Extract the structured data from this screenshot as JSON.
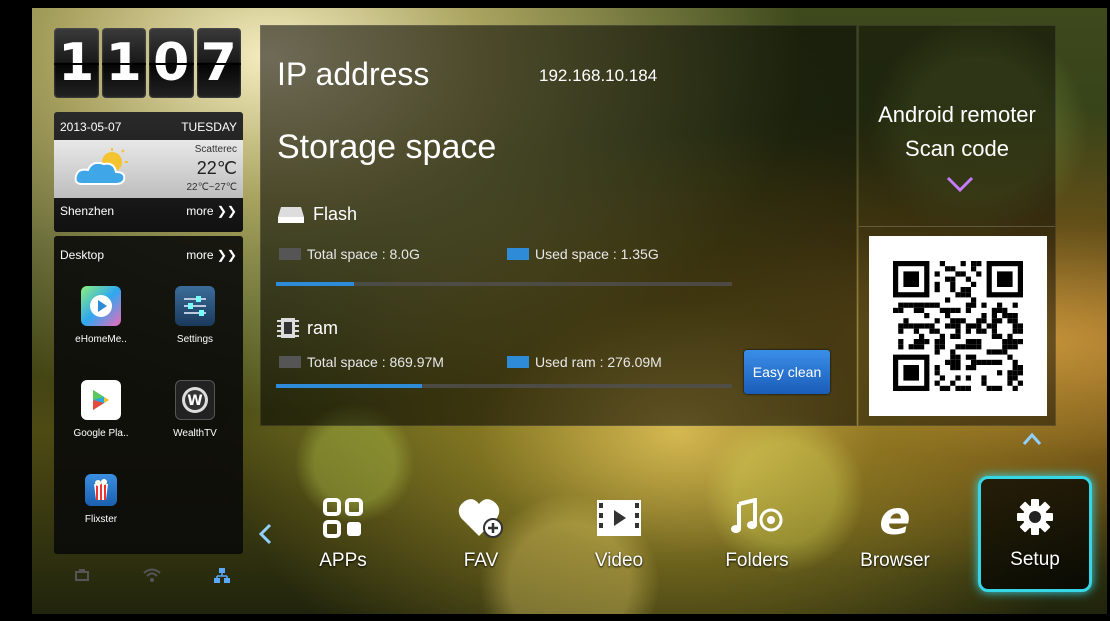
{
  "clock": {
    "digits": [
      "1",
      "1",
      "0",
      "7"
    ]
  },
  "weather": {
    "date": "2013-05-07",
    "weekday": "TUESDAY",
    "description": "Scatterec",
    "temperature": "22℃",
    "range": "22℃~27℃",
    "city": "Shenzhen",
    "more": "more ❯❯"
  },
  "desktop": {
    "title": "Desktop",
    "more": "more ❯❯",
    "apps": [
      {
        "label": "eHomeMe..",
        "icon": "ehome-media-icon"
      },
      {
        "label": "Settings",
        "icon": "settings-app-icon"
      },
      {
        "label": "Google Pla..",
        "icon": "google-play-icon"
      },
      {
        "label": "WealthTV",
        "icon": "wealthtv-icon"
      },
      {
        "label": "Flixster",
        "icon": "flixster-icon"
      }
    ]
  },
  "info": {
    "ip_label": "IP address",
    "ip_value": "192.168.10.184",
    "storage_title": "Storage space",
    "flash": {
      "title": "Flash",
      "total": "Total space : 8.0G",
      "used": "Used space : 1.35G",
      "used_fraction": 0.17
    },
    "ram": {
      "title": "ram",
      "total": "Total space : 869.97M",
      "used": "Used ram : 276.09M",
      "used_fraction": 0.32
    },
    "easy_clean": "Easy clean"
  },
  "remote": {
    "line1": "Android remoter",
    "line2": "Scan code"
  },
  "dock": [
    {
      "label": "APPs",
      "icon": "apps-grid-icon"
    },
    {
      "label": "FAV",
      "icon": "favorite-heart-icon"
    },
    {
      "label": "Video",
      "icon": "video-icon"
    },
    {
      "label": "Folders",
      "icon": "music-folder-icon"
    },
    {
      "label": "Browser",
      "icon": "browser-icon"
    },
    {
      "label": "Setup",
      "icon": "gear-icon",
      "selected": true
    }
  ],
  "colors": {
    "accent": "#37d6e6",
    "bar_fill": "#2e8bd8",
    "button": "#2a7ad8"
  }
}
